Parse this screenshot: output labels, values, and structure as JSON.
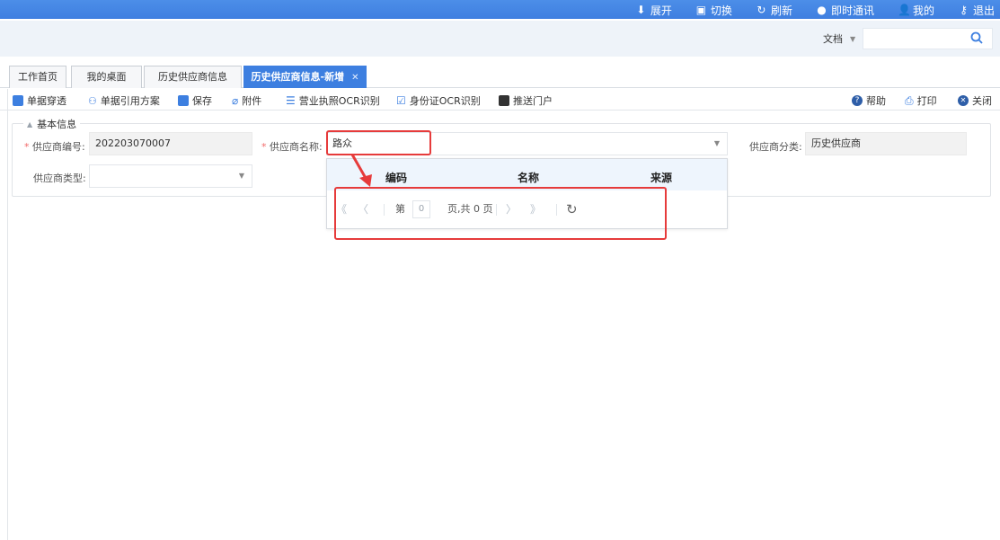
{
  "topbar": {
    "items": [
      {
        "label": "展开",
        "icon": "download-icon"
      },
      {
        "label": "切换",
        "icon": "switch-icon"
      },
      {
        "label": "刷新",
        "icon": "refresh-icon"
      },
      {
        "label": "即时通讯",
        "icon": "chat-icon"
      },
      {
        "label": "我的",
        "icon": "user-icon"
      },
      {
        "label": "退出",
        "icon": "key-icon"
      }
    ]
  },
  "search": {
    "scope_label": "文档",
    "value": ""
  },
  "tabs": [
    {
      "label": "工作首页"
    },
    {
      "label": "我的桌面"
    },
    {
      "label": "历史供应商信息"
    },
    {
      "label": "历史供应商信息-新增",
      "active": true
    }
  ],
  "toolbar": {
    "left": [
      {
        "label": "单据穿透",
        "icon": "document-icon",
        "color": "#3d7fe0"
      },
      {
        "label": "单据引用方案",
        "icon": "link-icon",
        "color": "#3d7fe0"
      },
      {
        "label": "保存",
        "icon": "save-icon",
        "color": "#3d7fe0"
      },
      {
        "label": "附件",
        "icon": "paperclip-icon",
        "color": "#3d7fe0"
      },
      {
        "label": "营业执照OCR识别",
        "icon": "license-icon",
        "color": "#3d7fe0"
      },
      {
        "label": "身份证OCR识别",
        "icon": "id-card-icon",
        "color": "#3d7fe0"
      },
      {
        "label": "推送门户",
        "icon": "push-icon",
        "color": "#333333"
      }
    ],
    "right": [
      {
        "label": "帮助",
        "icon": "help-icon"
      },
      {
        "label": "打印",
        "icon": "print-icon"
      },
      {
        "label": "关闭",
        "icon": "close-circle-icon"
      }
    ]
  },
  "form": {
    "section_title": "基本信息",
    "supplier_code_label": "供应商编号:",
    "supplier_code_value": "202203070007",
    "supplier_name_label": "供应商名称:",
    "supplier_name_value": "路众",
    "supplier_category_label": "供应商分类:",
    "supplier_category_value": "历史供应商",
    "supplier_type_label": "供应商类型:",
    "supplier_type_value": ""
  },
  "dropdown": {
    "columns": [
      "编码",
      "名称",
      "来源"
    ],
    "pager": {
      "page_prefix": "第",
      "page_value": "0",
      "page_suffix": "页,共 0 页"
    }
  },
  "colors": {
    "accent": "#3d7fe0",
    "annotation": "#e63b3b",
    "required": "#f26b6b"
  }
}
